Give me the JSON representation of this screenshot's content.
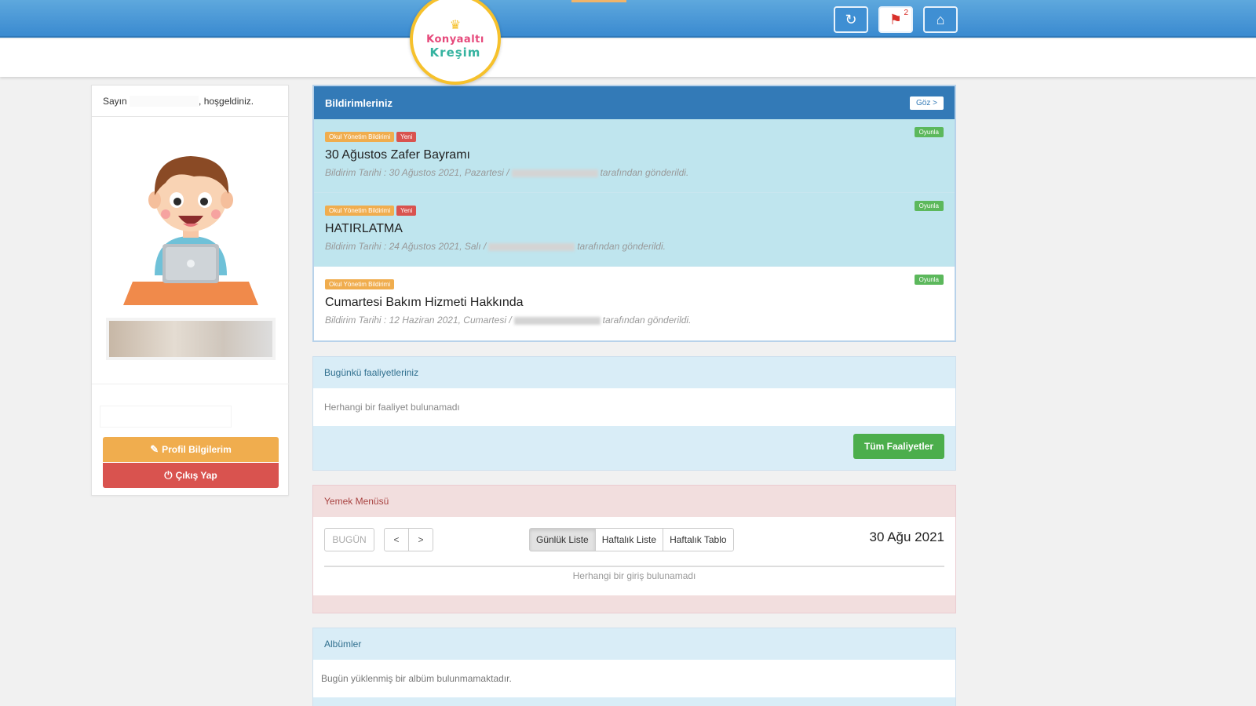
{
  "header": {
    "logo_line1": "Konyaaltı",
    "logo_line2": "Kreşim",
    "refresh_icon": "refresh-icon",
    "messages_icon": "message-flag-icon",
    "messages_count": "2",
    "home_icon": "school-icon"
  },
  "profile": {
    "greeting_prefix": "Sayın",
    "greeting_suffix": ", hoşgeldiniz.",
    "profile_button": "Profil Bilgilerim",
    "logout_button": "Çıkış Yap"
  },
  "notifications": {
    "title": "Bildirimleriniz",
    "all_button": "Göz >",
    "items": [
      {
        "category": "Okul Yönetim Bildirimi",
        "new_tag": "Yeni",
        "view_tag": "Oyunla",
        "title": "30 Ağustos Zafer Bayramı",
        "meta_prefix": "Bildirim Tarihi : 30 Ağustos 2021, Pazartesi /",
        "meta_suffix": "tarafından gönderildi."
      },
      {
        "category": "Okul Yönetim Bildirimi",
        "new_tag": "Yeni",
        "view_tag": "Oyunla",
        "title": "HATIRLATMA",
        "meta_prefix": "Bildirim Tarihi : 24 Ağustos 2021, Salı /",
        "meta_suffix": "tarafından gönderildi."
      },
      {
        "category": "Okul Yönetim Bildirimi",
        "new_tag": "",
        "view_tag": "Oyunla",
        "title": "Cumartesi Bakım Hizmeti Hakkında",
        "meta_prefix": "Bildirim Tarihi : 12 Haziran 2021, Cumartesi /",
        "meta_suffix": "tarafından gönderildi."
      }
    ]
  },
  "activities": {
    "title": "Bugünkü faaliyetleriniz",
    "empty": "Herhangi bir faaliyet bulunamadı",
    "all_button": "Tüm Faaliyetler"
  },
  "meal": {
    "title": "Yemek Menüsü",
    "today": "BUGÜN",
    "prev": "<",
    "next": ">",
    "views": [
      "Günlük Liste",
      "Haftalık Liste",
      "Haftalık Tablo"
    ],
    "date": "30 Ağu 2021",
    "empty": "Herhangi bir giriş bulunamadı"
  },
  "albums": {
    "title": "Albümler",
    "empty": "Bugün yüklenmiş bir albüm bulunmamaktadır."
  },
  "colors": {
    "primary": "#337ab7",
    "warning": "#f0ad4e",
    "danger": "#d9534f",
    "success": "#5cb85c",
    "info_bg": "#d9edf7",
    "danger_bg": "#f2dede"
  }
}
